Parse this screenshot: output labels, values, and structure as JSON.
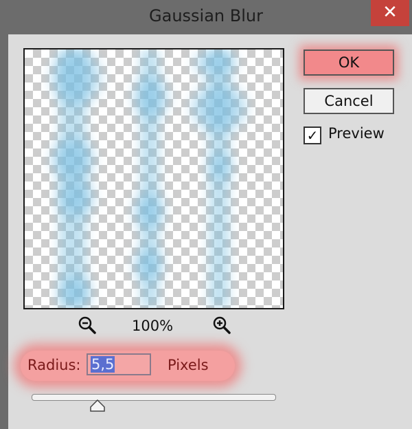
{
  "window": {
    "title": "Gaussian Blur",
    "close_glyph": "✕"
  },
  "buttons": {
    "ok_label": "OK",
    "cancel_label": "Cancel"
  },
  "preview_option": {
    "label": "Preview",
    "checked": true,
    "check_glyph": "✓"
  },
  "zoom": {
    "level": "100%"
  },
  "radius": {
    "label": "Radius:",
    "value": "5,5",
    "unit": "Pixels",
    "slider_fraction": 0.27
  },
  "colors": {
    "ok_highlight": "#f2898b",
    "radius_highlight": "#f4a0a0",
    "selection": "#5b6fd0",
    "blur_color": "#78bee1"
  }
}
